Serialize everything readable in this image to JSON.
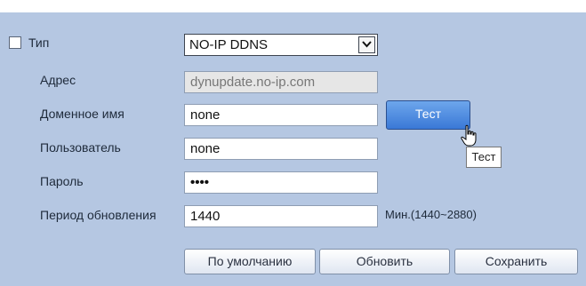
{
  "form": {
    "type": {
      "label": "Тип",
      "value": "NO-IP DDNS"
    },
    "address": {
      "label": "Адрес",
      "value": "dynupdate.no-ip.com"
    },
    "domain": {
      "label": "Доменное имя",
      "value": "none"
    },
    "user": {
      "label": "Пользователь",
      "value": "none"
    },
    "password": {
      "label": "Пароль",
      "value": "••••"
    },
    "period": {
      "label": "Период обновления",
      "value": "1440",
      "unit": "Мин.(1440~2880)"
    }
  },
  "test_button": {
    "label": "Тест",
    "tooltip": "Тест"
  },
  "actions": {
    "default": "По умолчанию",
    "refresh": "Обновить",
    "save": "Сохранить"
  },
  "colors": {
    "panel": "#b5c7e2",
    "test_button": "#4a86de"
  },
  "icons": {
    "cursor": "hand-pointer-icon",
    "dropdown": "chevron-down-icon"
  }
}
